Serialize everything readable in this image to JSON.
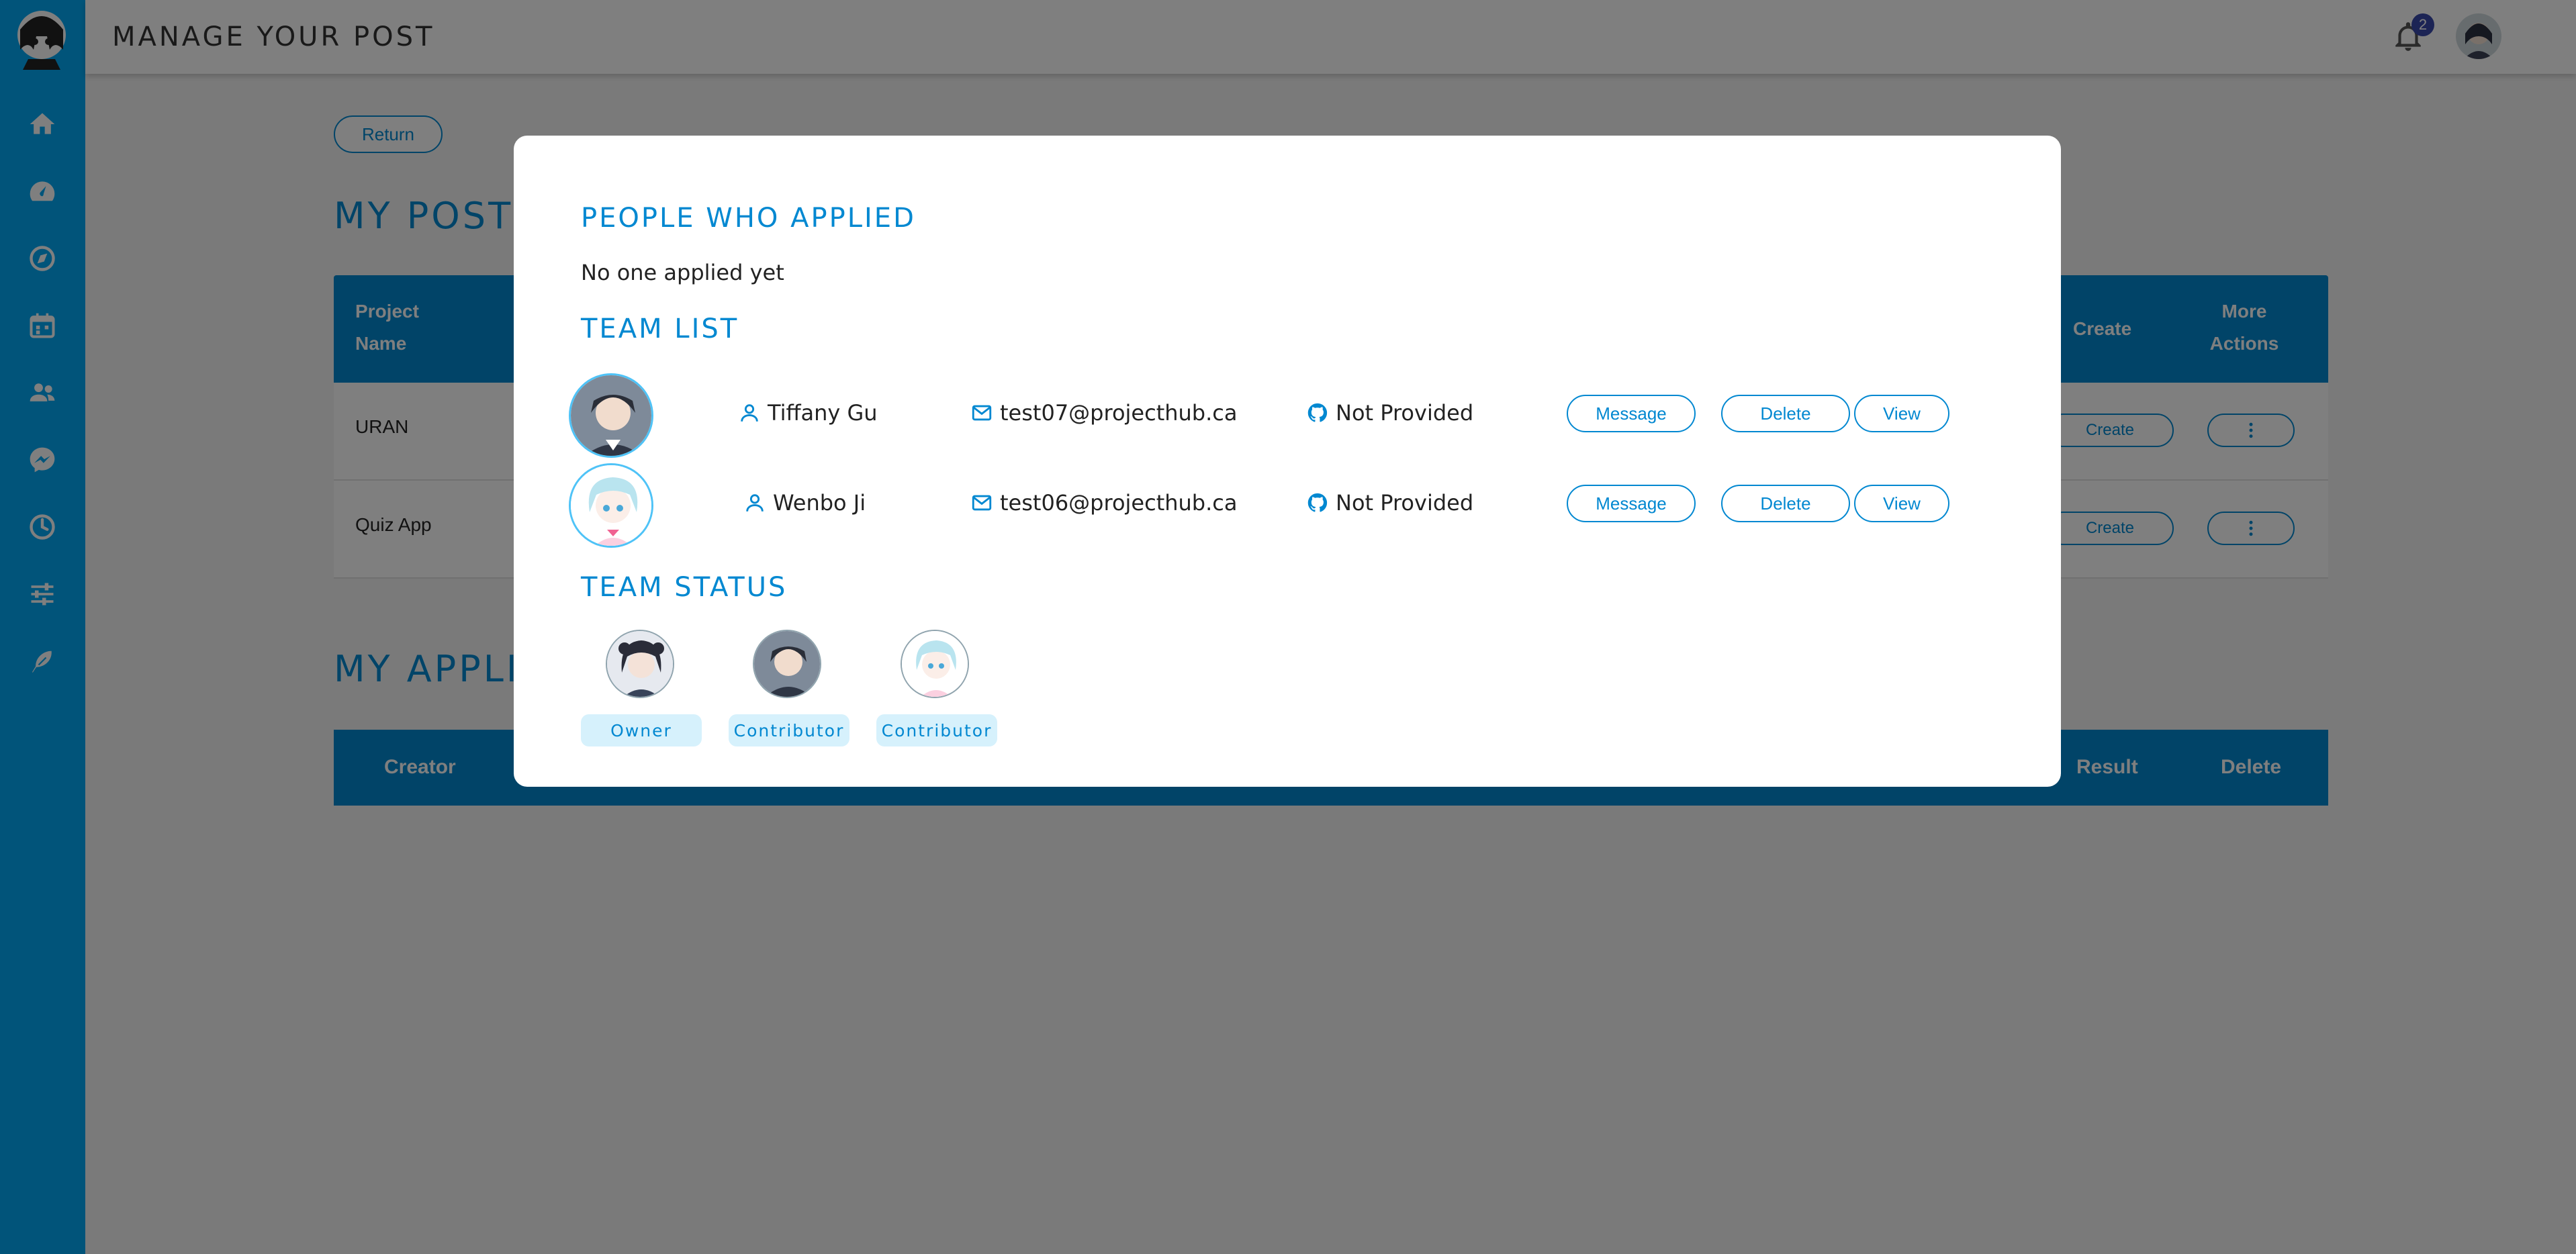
{
  "header": {
    "title": "MANAGE YOUR POST",
    "notification_count": "2"
  },
  "sidebar": {
    "items": [
      {
        "icon": "home-icon"
      },
      {
        "icon": "dashboard-icon"
      },
      {
        "icon": "explore-icon"
      },
      {
        "icon": "calendar-icon"
      },
      {
        "icon": "people-icon"
      },
      {
        "icon": "messenger-icon"
      },
      {
        "icon": "clock-icon"
      },
      {
        "icon": "settings-sliders-icon"
      },
      {
        "icon": "feather-icon"
      }
    ]
  },
  "background": {
    "return_label": "Return",
    "my_posts_heading": "MY POSTS",
    "posts_table": {
      "headers": [
        "Project Name",
        "Create",
        "More Actions"
      ],
      "rows": [
        {
          "name": "URAN",
          "create_btn": "Create"
        },
        {
          "name": "Quiz App",
          "create_btn": "Create"
        }
      ]
    },
    "my_applications_heading": "MY APPLICATIONS",
    "applications_table": {
      "headers": [
        "Creator",
        "Result",
        "Delete"
      ]
    }
  },
  "modal": {
    "applied_heading": "PEOPLE WHO APPLIED",
    "applied_empty": "No one applied yet",
    "team_heading": "TEAM LIST",
    "team": [
      {
        "name": "Tiffany Gu",
        "email": "test07@projecthub.ca",
        "github": "Not Provided",
        "message_label": "Message",
        "delete_label": "Delete",
        "view_label": "View"
      },
      {
        "name": "Wenbo Ji",
        "email": "test06@projecthub.ca",
        "github": "Not Provided",
        "message_label": "Message",
        "delete_label": "Delete",
        "view_label": "View"
      }
    ],
    "status_heading": "TEAM STATUS",
    "status": [
      {
        "role": "Owner"
      },
      {
        "role": "Contributor"
      },
      {
        "role": "Contributor"
      }
    ]
  },
  "colors": {
    "primary": "#03a9f4",
    "primary_dark": "#0288d1",
    "badge": "#3949ab",
    "role_badge_bg": "#d6f1fc"
  }
}
